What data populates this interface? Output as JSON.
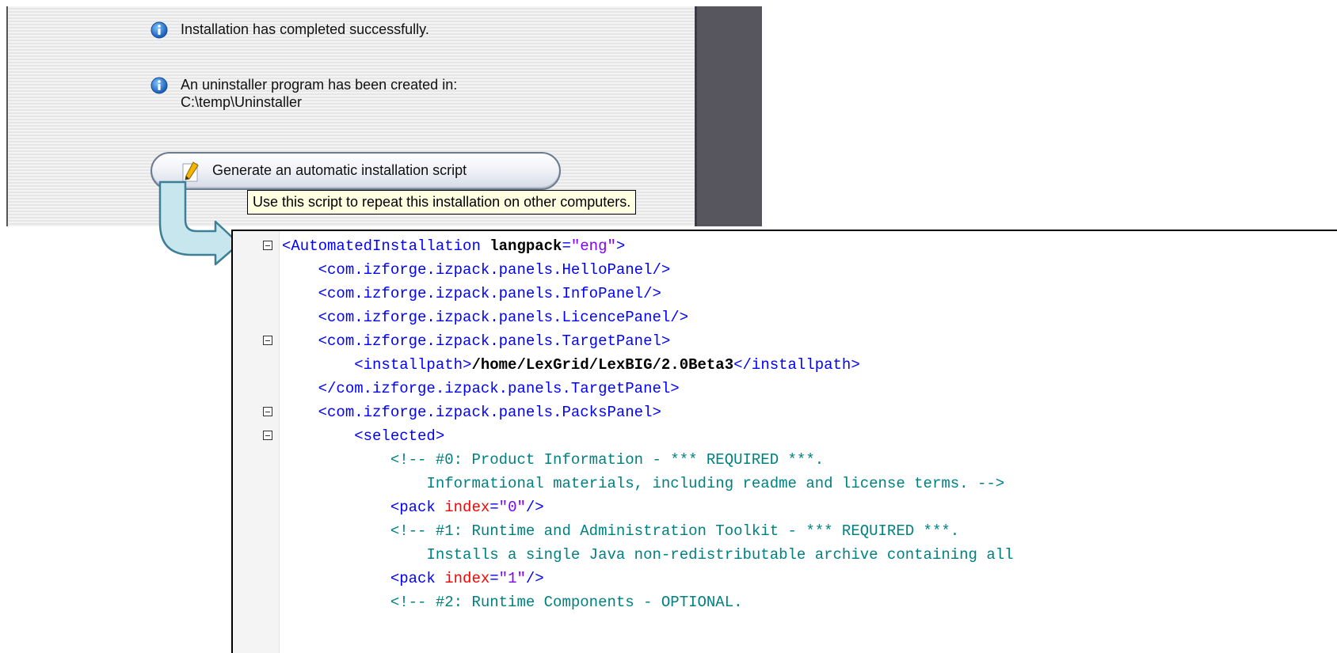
{
  "installer": {
    "message_success": "Installation has completed successfully.",
    "message_uninstaller_line1": "An uninstaller program has been created in:",
    "message_uninstaller_line2": "C:\\temp\\Uninstaller",
    "generate_button_label": "Generate an automatic installation script",
    "tooltip": "Use this script to repeat this installation on other computers."
  },
  "editor": {
    "lines": [
      {
        "fold": true,
        "indent": 0,
        "parts": [
          [
            "t-tag",
            "<AutomatedInstallation"
          ],
          [
            "t-text",
            " langpack"
          ],
          [
            "t-tag",
            "="
          ],
          [
            "t-val",
            "\"eng\""
          ],
          [
            "t-tag",
            ">"
          ]
        ]
      },
      {
        "fold": false,
        "indent": 1,
        "parts": [
          [
            "t-tag",
            "<com.izforge.izpack.panels.HelloPanel/>"
          ]
        ]
      },
      {
        "fold": false,
        "indent": 1,
        "parts": [
          [
            "t-tag",
            "<com.izforge.izpack.panels.InfoPanel/>"
          ]
        ]
      },
      {
        "fold": false,
        "indent": 1,
        "parts": [
          [
            "t-tag",
            "<com.izforge.izpack.panels.LicencePanel/>"
          ]
        ]
      },
      {
        "fold": true,
        "indent": 1,
        "parts": [
          [
            "t-tag",
            "<com.izforge.izpack.panels.TargetPanel>"
          ]
        ]
      },
      {
        "fold": false,
        "indent": 2,
        "parts": [
          [
            "t-tag",
            "<installpath>"
          ],
          [
            "t-text",
            "/home/LexGrid/LexBIG/2.0Beta3"
          ],
          [
            "t-tag",
            "</installpath>"
          ]
        ]
      },
      {
        "fold": false,
        "indent": 1,
        "parts": [
          [
            "t-tag",
            "</com.izforge.izpack.panels.TargetPanel>"
          ]
        ]
      },
      {
        "fold": true,
        "indent": 1,
        "parts": [
          [
            "t-tag",
            "<com.izforge.izpack.panels.PacksPanel>"
          ]
        ]
      },
      {
        "fold": true,
        "indent": 2,
        "parts": [
          [
            "t-tag",
            "<selected>"
          ]
        ]
      },
      {
        "fold": false,
        "indent": 3,
        "parts": [
          [
            "t-comment",
            "<!-- #0: Product Information - *** REQUIRED ***."
          ]
        ]
      },
      {
        "fold": false,
        "indent": 4,
        "parts": [
          [
            "t-comment",
            "Informational materials, including readme and license terms. -->"
          ]
        ]
      },
      {
        "fold": false,
        "indent": 3,
        "parts": [
          [
            "t-tag",
            "<pack"
          ],
          [
            "t-attr",
            " index"
          ],
          [
            "t-tag",
            "="
          ],
          [
            "t-val",
            "\"0\""
          ],
          [
            "t-tag",
            "/>"
          ]
        ]
      },
      {
        "fold": false,
        "indent": 3,
        "parts": [
          [
            "t-comment",
            "<!-- #1: Runtime and Administration Toolkit - *** REQUIRED ***."
          ]
        ]
      },
      {
        "fold": false,
        "indent": 4,
        "parts": [
          [
            "t-comment",
            "Installs a single Java non-redistributable archive containing all"
          ]
        ]
      },
      {
        "fold": false,
        "indent": 3,
        "parts": [
          [
            "t-tag",
            "<pack"
          ],
          [
            "t-attr",
            " index"
          ],
          [
            "t-tag",
            "="
          ],
          [
            "t-val",
            "\"1\""
          ],
          [
            "t-tag",
            "/>"
          ]
        ]
      },
      {
        "fold": false,
        "indent": 3,
        "parts": [
          [
            "t-comment",
            "<!-- #2: Runtime Components - OPTIONAL."
          ]
        ]
      }
    ]
  }
}
